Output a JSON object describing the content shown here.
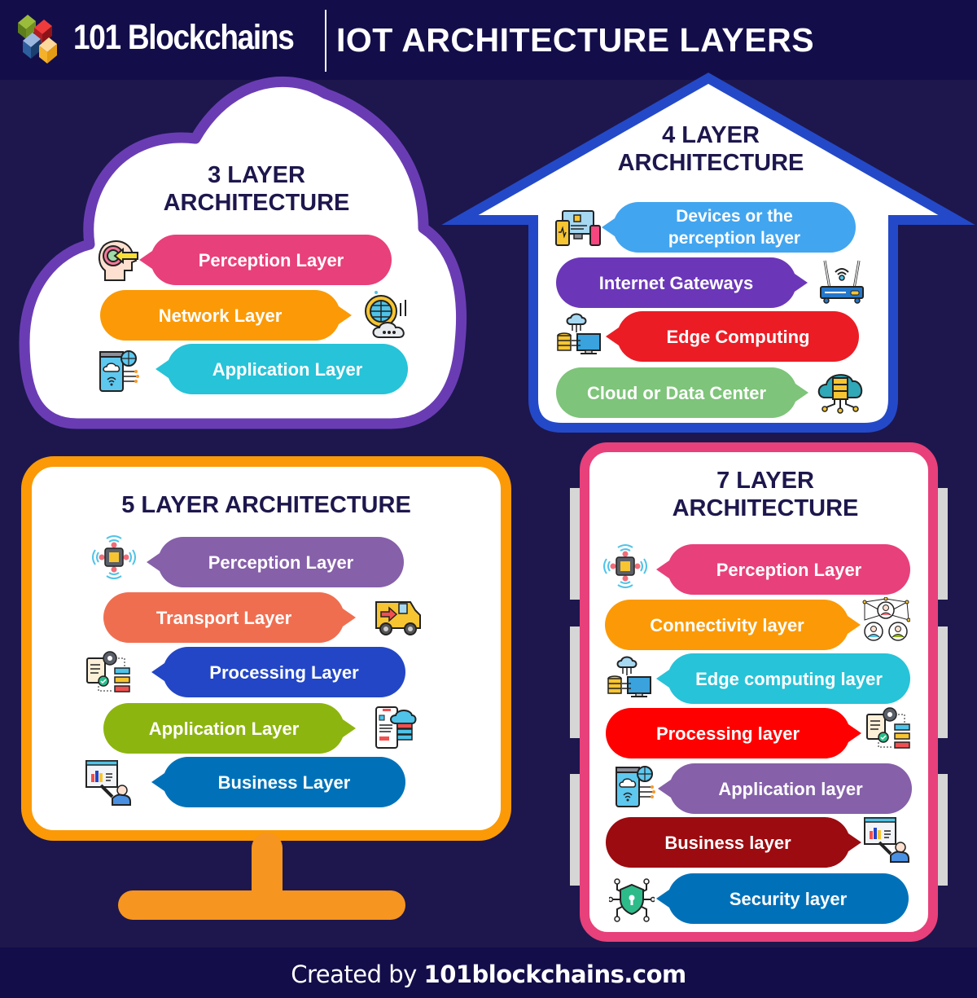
{
  "header": {
    "brand": "101 Blockchains",
    "title": "IOT ARCHITECTURE LAYERS",
    "logo_colors": [
      "#6b8e23",
      "#c0232b",
      "#2d5d9c",
      "#f5b12a"
    ]
  },
  "sections": {
    "three": {
      "title_line1": "3 LAYER",
      "title_line2": "ARCHITECTURE",
      "frame_shape": "cloud",
      "frame_color": "#6a3cb4",
      "layers": [
        {
          "label": "Perception Layer",
          "color": "#e8407a",
          "icon": "mind-target-icon"
        },
        {
          "label": "Network Layer",
          "color": "#fb9a06",
          "icon": "globe-cloud-gear-icon"
        },
        {
          "label": "Application Layer",
          "color": "#27c3d8",
          "icon": "mobile-cloud-app-icon"
        }
      ]
    },
    "four": {
      "title_line1": "4 LAYER",
      "title_line2": "ARCHITECTURE",
      "frame_shape": "house",
      "frame_color": "#2449c8",
      "layers": [
        {
          "label": "Devices or the perception layer",
          "label_line1": "Devices or the",
          "label_line2": "perception layer",
          "color": "#42a5f0",
          "icon": "devices-icon"
        },
        {
          "label": "Internet Gateways",
          "color": "#6b37b8",
          "icon": "router-icon"
        },
        {
          "label": "Edge Computing",
          "color": "#ec1c24",
          "icon": "edge-computing-icon"
        },
        {
          "label": "Cloud or Data Center",
          "color": "#7ec47a",
          "icon": "cloud-server-icon"
        }
      ]
    },
    "five": {
      "title": "5 LAYER ARCHITECTURE",
      "frame_shape": "monitor",
      "frame_color": "#fb9a06",
      "stand_color": "#f6951f",
      "layers": [
        {
          "label": "Perception Layer",
          "color": "#8660a9",
          "icon": "sensor-chip-icon"
        },
        {
          "label": "Transport Layer",
          "color": "#f06e50",
          "icon": "delivery-truck-icon"
        },
        {
          "label": "Processing Layer",
          "color": "#2346c6",
          "icon": "process-workflow-icon"
        },
        {
          "label": "Application Layer",
          "color": "#8db50f",
          "icon": "app-cloud-server-icon"
        },
        {
          "label": "Business Layer",
          "color": "#0071b9",
          "icon": "business-presentation-icon"
        }
      ]
    },
    "seven": {
      "title_line1": "7 LAYER",
      "title_line2": "ARCHITECTURE",
      "frame_shape": "server-rack",
      "frame_color": "#e8407a",
      "layers": [
        {
          "label": "Perception Layer",
          "color": "#e8407a",
          "icon": "sensor-chip-icon"
        },
        {
          "label": "Connectivity layer",
          "color": "#fb9a06",
          "icon": "people-network-icon"
        },
        {
          "label": "Edge computing layer",
          "color": "#27c3d8",
          "icon": "edge-computing-icon"
        },
        {
          "label": "Processing layer",
          "color": "#ff0000",
          "icon": "process-workflow-icon"
        },
        {
          "label": "Application layer",
          "color": "#8660a9",
          "icon": "mobile-cloud-app-icon"
        },
        {
          "label": "Business layer",
          "color": "#9b0b10",
          "icon": "business-presentation-icon"
        },
        {
          "label": "Security layer",
          "color": "#0071b9",
          "icon": "security-shield-icon"
        }
      ]
    }
  },
  "footer": {
    "prefix": "Created by ",
    "site": "101blockchains.com"
  }
}
